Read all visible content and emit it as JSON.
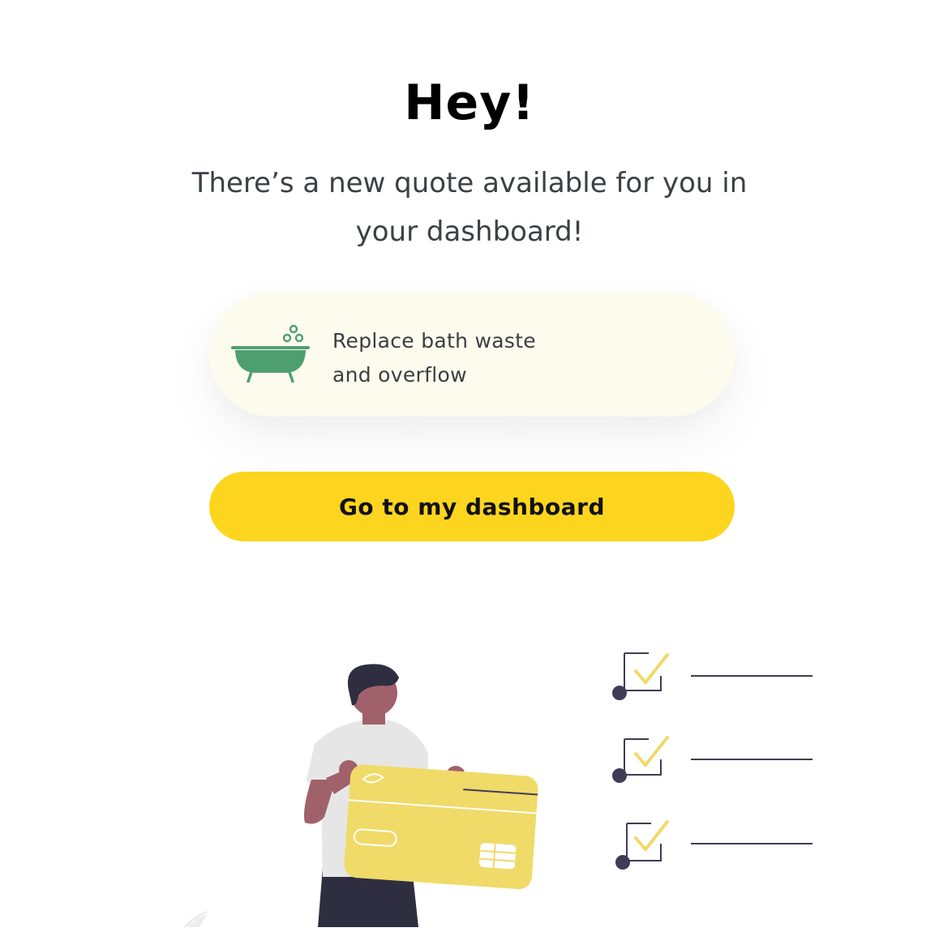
{
  "greeting": {
    "title": "Hey!",
    "message": "There’s a new quote available for you in your dashboard!"
  },
  "quote": {
    "icon": "bathtub-icon",
    "label_line1": "Replace bath waste",
    "label_line2": "and overflow"
  },
  "cta": {
    "label": "Go to my dashboard"
  },
  "colors": {
    "accent_yellow": "#FED51E",
    "card_background": "#FDFBEE",
    "icon_green": "#4E9F6F",
    "card_yellow": "#F0DA68",
    "dark_navy": "#3F3D56"
  }
}
